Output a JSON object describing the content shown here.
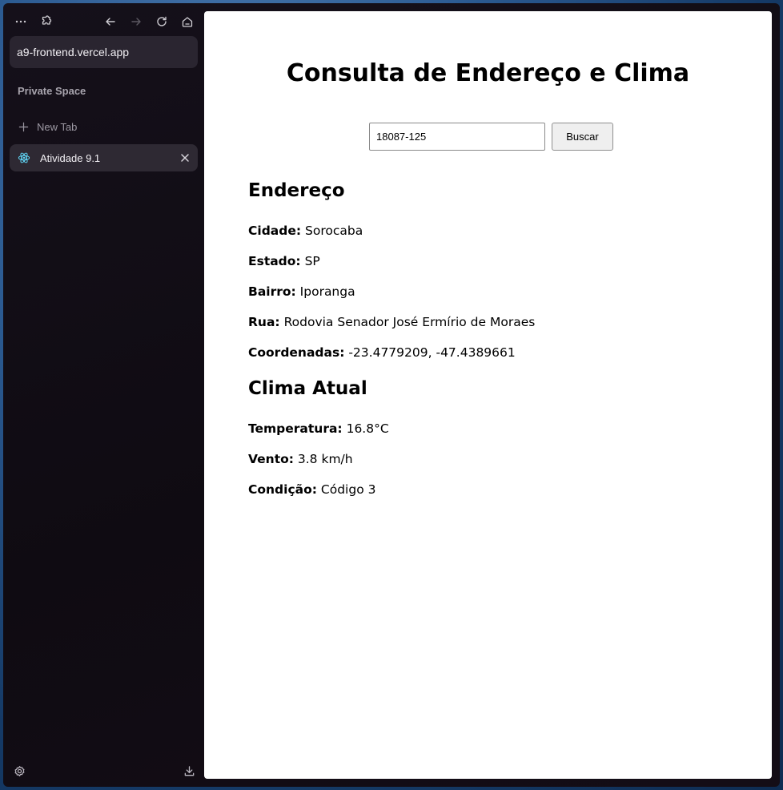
{
  "browser": {
    "url": "a9-frontend.vercel.app",
    "space_label": "Private Space",
    "new_tab_label": "New Tab",
    "tabs": [
      {
        "title": "Atividade 9.1",
        "favicon": "react-icon"
      }
    ],
    "toolbar_icons": [
      "more-icon",
      "extensions-icon",
      "back-arrow-icon",
      "forward-arrow-icon",
      "reload-icon",
      "home-icon"
    ],
    "bottom_icons": [
      "settings-icon",
      "download-icon"
    ]
  },
  "page": {
    "title": "Consulta de Endereço e Clima",
    "search": {
      "value": "18087-125",
      "button_label": "Buscar"
    },
    "address": {
      "heading": "Endereço",
      "fields": [
        {
          "label": "Cidade:",
          "value": "Sorocaba"
        },
        {
          "label": "Estado:",
          "value": "SP"
        },
        {
          "label": "Bairro:",
          "value": "Iporanga"
        },
        {
          "label": "Rua:",
          "value": "Rodovia Senador José Ermírio de Moraes"
        },
        {
          "label": "Coordenadas:",
          "value": "-23.4779209, -47.4389661"
        }
      ]
    },
    "weather": {
      "heading": "Clima Atual",
      "fields": [
        {
          "label": "Temperatura:",
          "value": "16.8°C"
        },
        {
          "label": "Vento:",
          "value": "3.8 km/h"
        },
        {
          "label": "Condição:",
          "value": "Código 3"
        }
      ]
    }
  },
  "colors": {
    "sidebar_bg": "#120e15",
    "urlbar_bg": "#2a2530",
    "tab_active_bg": "#2e2933",
    "react_blue": "#61dafb"
  }
}
